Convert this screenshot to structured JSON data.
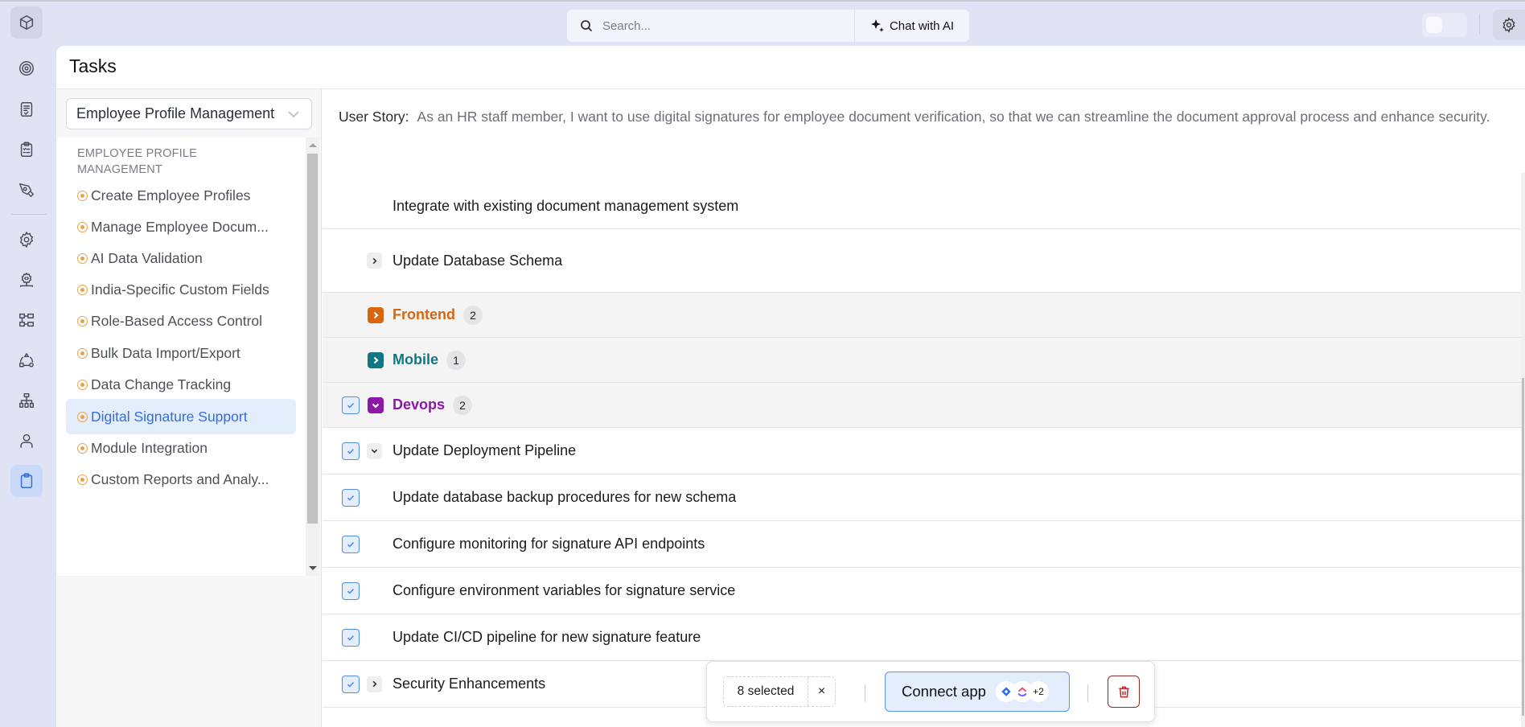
{
  "topbar": {
    "search_placeholder": "Search...",
    "chat_label": "Chat with AI"
  },
  "rail": {
    "items": [
      {
        "icon": "cube-icon",
        "label": "Home"
      },
      {
        "icon": "target-icon",
        "label": "Goals"
      },
      {
        "icon": "document-check-icon",
        "label": "Documents"
      },
      {
        "icon": "clipboard-list-icon",
        "label": "Checklist"
      },
      {
        "icon": "pen-tool-icon",
        "label": "Design"
      },
      {
        "icon": "settings-icon",
        "label": "Settings"
      },
      {
        "icon": "code-gear-icon",
        "label": "Developer"
      },
      {
        "icon": "workflow-icon",
        "label": "Workflows"
      },
      {
        "icon": "shapes-cycle-icon",
        "label": "Components"
      },
      {
        "icon": "org-chart-icon",
        "label": "Hierarchy"
      },
      {
        "icon": "user-icon",
        "label": "Users"
      },
      {
        "icon": "clipboard-icon",
        "label": "Tasks",
        "active": true
      }
    ]
  },
  "page": {
    "title": "Tasks"
  },
  "left_pane": {
    "dropdown_value": "Employee Profile Management",
    "category": "EMPLOYEE PROFILE MANAGEMENT",
    "items": [
      {
        "label": "Create Employee Profiles"
      },
      {
        "label": "Manage Employee Docum..."
      },
      {
        "label": "AI Data Validation"
      },
      {
        "label": "India-Specific Custom Fields"
      },
      {
        "label": "Role-Based Access Control"
      },
      {
        "label": "Bulk Data Import/Export"
      },
      {
        "label": "Data Change Tracking"
      },
      {
        "label": "Digital Signature Support",
        "active": true
      },
      {
        "label": "Module Integration"
      },
      {
        "label": "Custom Reports and Analy..."
      }
    ]
  },
  "content": {
    "story_label": "User Story:",
    "story_text": "As an HR staff member, I want to use digital signatures for employee document verification, so that we can streamline the document approval process and enhance security.",
    "rows": [
      {
        "type": "task",
        "label": "Integrate with existing document management system",
        "checked": false,
        "expander": "none"
      },
      {
        "type": "task",
        "label": "Update Database Schema",
        "checked": false,
        "expander": "collapsed"
      },
      {
        "type": "group",
        "label": "Frontend",
        "count": "2",
        "color": "#d9650f",
        "expanded": false,
        "checked": false
      },
      {
        "type": "group",
        "label": "Mobile",
        "count": "1",
        "color": "#127785",
        "expanded": false,
        "checked": false
      },
      {
        "type": "group",
        "label": "Devops",
        "count": "2",
        "color": "#8e17a8",
        "expanded": true,
        "checked": true
      },
      {
        "type": "task",
        "label": "Update Deployment Pipeline",
        "checked": true,
        "expander": "expanded"
      },
      {
        "type": "task",
        "label": "Update database backup procedures for new schema",
        "checked": true,
        "expander": "none"
      },
      {
        "type": "task",
        "label": "Configure monitoring for signature API endpoints",
        "checked": true,
        "expander": "none"
      },
      {
        "type": "task",
        "label": "Configure environment variables for signature service",
        "checked": true,
        "expander": "none"
      },
      {
        "type": "task",
        "label": "Update CI/CD pipeline for new signature feature",
        "checked": true,
        "expander": "none"
      },
      {
        "type": "task",
        "label": "Security Enhancements",
        "checked": true,
        "expander": "collapsed"
      }
    ]
  },
  "bulk_bar": {
    "selected_label": "8 selected",
    "clear_label": "×",
    "connect_label": "Connect app",
    "apps": [
      "jira-icon",
      "clickup-icon"
    ],
    "more_apps": "+2"
  },
  "colors": {
    "accent": "#2f6fe0",
    "frontend": "#d9650f",
    "mobile": "#127785",
    "devops": "#8e17a8",
    "danger": "#c0282d"
  }
}
